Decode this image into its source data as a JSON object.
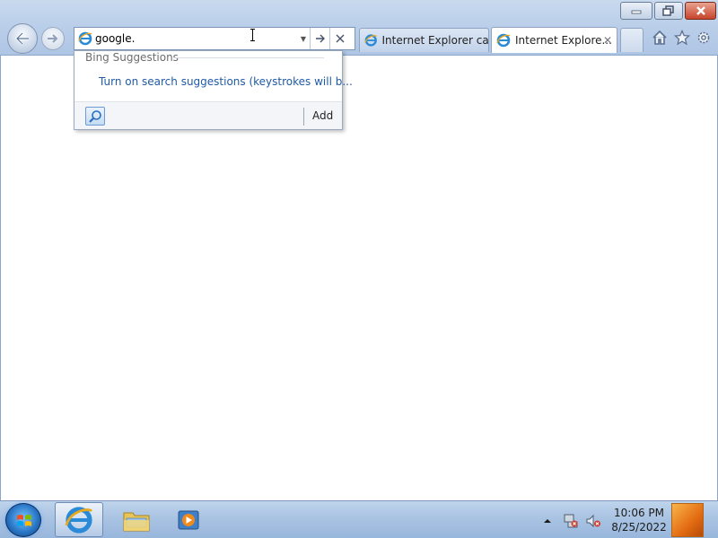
{
  "window": {
    "caption_buttons": [
      "minimize-icon",
      "restore-icon",
      "close-icon"
    ]
  },
  "navigation": {
    "back_icon": "arrow-left-icon",
    "forward_icon": "arrow-right-icon"
  },
  "address_bar": {
    "value": "google.",
    "icon": "ie-icon",
    "dropdown_icon": "chevron-down-icon",
    "go_icon": "arrow-right-icon",
    "stop_icon": "close-icon"
  },
  "tabs": [
    {
      "label": "Internet Explorer ca...",
      "active": false
    },
    {
      "label": "Internet Explore...",
      "active": true,
      "close": "✕"
    }
  ],
  "toolbar_icons": [
    "home-icon",
    "star-icon",
    "gear-icon"
  ],
  "suggestions": {
    "header": "Bing Suggestions",
    "link": "Turn on search suggestions (keystrokes will b...",
    "add_label": "Add"
  },
  "taskbar": {
    "items": [
      "internet-explorer",
      "windows-explorer",
      "media-player"
    ],
    "clock_time": "10:06 PM",
    "clock_date": "8/25/2022"
  },
  "colors": {
    "link": "#1f5aa6",
    "close_button": "#c8442c",
    "taskbar": "#a9c3e2"
  }
}
